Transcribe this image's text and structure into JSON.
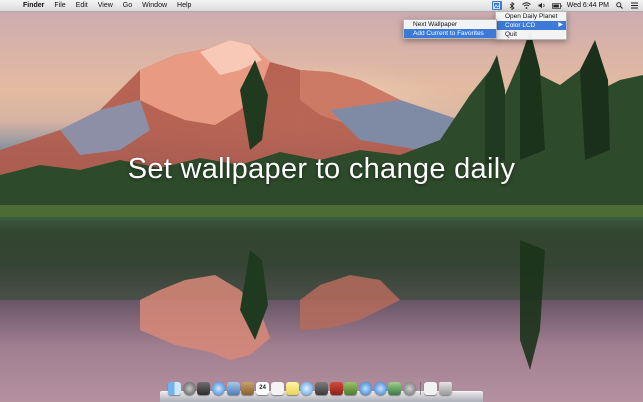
{
  "menubar": {
    "apple": "",
    "app_name": "Finder",
    "menus": [
      "File",
      "Edit",
      "View",
      "Go",
      "Window",
      "Help"
    ],
    "clock": "Wed 6:44 PM"
  },
  "caption": "Set wallpaper to change daily",
  "status_menu": {
    "items": [
      "Open Daily Planet",
      "Color LCD",
      "Quit"
    ],
    "selected_index": 1
  },
  "submenu": {
    "items": [
      "Next Wallpaper",
      "Add Current to Favorites"
    ],
    "selected_index": 1
  },
  "dock": {
    "icons": [
      "finder-icon",
      "launchpad-icon",
      "mission-control-icon",
      "safari-icon",
      "mail-icon",
      "contacts-icon",
      "calendar-icon",
      "reminders-icon",
      "notes-icon",
      "messages-icon",
      "facetime-icon",
      "photo-booth-icon",
      "iphoto-icon",
      "itunes-icon",
      "app-store-icon",
      "preview-icon",
      "system-preferences-icon",
      "documents-icon",
      "trash-icon"
    ],
    "calendar_day": "24"
  },
  "colors": {
    "menu_highlight": "#3b7ad9",
    "menubar_bg": "#e8e8e8"
  }
}
